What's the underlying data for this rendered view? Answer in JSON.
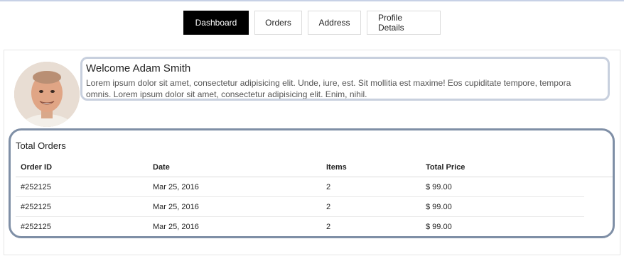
{
  "tabs": [
    {
      "label": "Dashboard",
      "active": true
    },
    {
      "label": "Orders",
      "active": false
    },
    {
      "label": "Address",
      "active": false
    },
    {
      "label": "Profile Details",
      "active": false
    }
  ],
  "profile": {
    "welcome": "Welcome Adam Smith",
    "text_line1": "Lorem ipsum dolor sit amet, consectetur adipisicing elit. Unde, iure, est. Sit mollitia est maxime! Eos cupiditate tempore, tempora",
    "text_line2": "omnis. Lorem ipsum dolor sit amet, consectetur adipisicing elit. Enim, nihil."
  },
  "orders": {
    "title": "Total Orders",
    "columns": [
      "Order ID",
      "Date",
      "Items",
      "Total Price"
    ],
    "rows": [
      [
        "#252125",
        "Mar 25, 2016",
        "2",
        "$ 99.00"
      ],
      [
        "#252125",
        "Mar 25, 2016",
        "2",
        "$ 99.00"
      ],
      [
        "#252125",
        "Mar 25, 2016",
        "2",
        "$ 99.00"
      ]
    ]
  },
  "colors": {
    "active_tab_bg": "#000000",
    "welcome_border": "#c8d0de",
    "orders_border": "#7f8fa6"
  }
}
